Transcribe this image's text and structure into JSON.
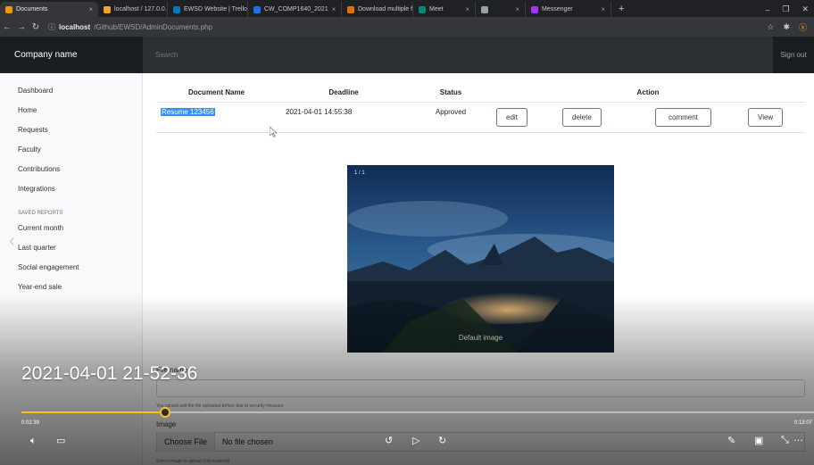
{
  "browser": {
    "tabs": [
      {
        "title": "Documents",
        "color": "#f29900",
        "active": true
      },
      {
        "title": "localhost / 127.0.0.1 /",
        "color": "#f5a623",
        "active": false
      },
      {
        "title": "EWSD Website | Trello",
        "color": "#0079bf",
        "active": false
      },
      {
        "title": "CW_COMP1640_2021",
        "color": "#1a73e8",
        "active": false
      },
      {
        "title": "Download multiple fil",
        "color": "#e37400",
        "active": false
      },
      {
        "title": "Meet",
        "color": "#00897b",
        "active": false
      },
      {
        "title": "",
        "color": "#9aa0a6",
        "active": false
      },
      {
        "title": "Messenger",
        "color": "#a334fa",
        "active": false
      }
    ],
    "new_tab": "+",
    "url_host": "localhost",
    "url_path": "/Github/EWSD/AdminDocuments.php"
  },
  "navbar": {
    "brand": "Company name",
    "search_placeholder": "Search",
    "signout": "Sign out"
  },
  "sidebar": {
    "items": [
      "Dashboard",
      "Home",
      "Requests",
      "Faculty",
      "Contributions",
      "Integrations"
    ],
    "saved_heading": "SAVED REPORTS",
    "saved_items": [
      "Current month",
      "Last quarter",
      "Social engagement",
      "Year-end sale"
    ]
  },
  "table": {
    "headers": [
      "Document Name",
      "Deadline",
      "Status",
      "Action"
    ],
    "row": {
      "name": "Resume 123456",
      "deadline": "2021-04-01 14:55:38",
      "status": "Approved",
      "actions": [
        "edit",
        "delete",
        "comment",
        "View"
      ]
    }
  },
  "image_viewer": {
    "counter": "1 / 1",
    "caption": "Default image"
  },
  "form": {
    "file_label": "File name",
    "file_help": "You cannot edit the file uploaded before due to security measure",
    "image_label": "Image",
    "choose_file": "Choose File",
    "no_file": "No file chosen",
    "image_help": "Select image to upload (not required)"
  },
  "video": {
    "title": "2021-04-01 21-52-36",
    "current_time": "0:02:39",
    "duration": "0:13:07",
    "progress": 0.181,
    "accent": "#f5c518"
  }
}
